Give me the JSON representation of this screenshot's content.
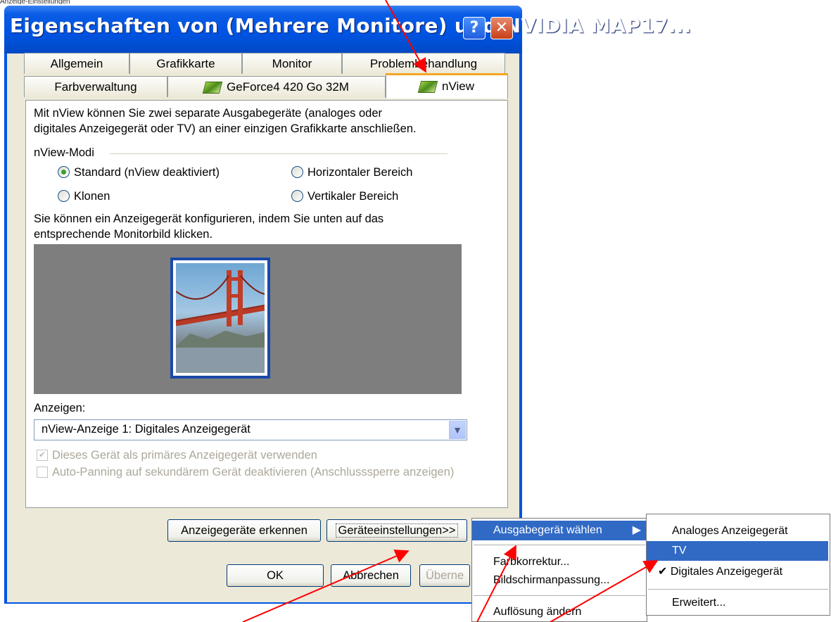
{
  "background": {
    "top_text": "Anzeige-Einstellungen"
  },
  "window": {
    "title": "Eigenschaften von (Mehrere Monitore) und NVIDIA MAP17...",
    "help_glyph": "?",
    "close_glyph": "✕"
  },
  "tabs": {
    "row1": [
      "Allgemein",
      "Grafikkarte",
      "Monitor",
      "Problembehandlung"
    ],
    "row2": [
      "Farbverwaltung",
      "GeForce4 420 Go 32M",
      "nView"
    ],
    "selected": "nView"
  },
  "nview": {
    "intro_line1": "Mit nView können Sie zwei separate Ausgabegeräte (analoges oder",
    "intro_line2": "digitales Anzeigegerät oder TV) an einer einzigen Grafikkarte anschließen.",
    "group_label": "nView-Modi",
    "modes": [
      {
        "label": "Standard (nView deaktiviert)",
        "selected": true
      },
      {
        "label": "Horizontaler Bereich",
        "selected": false
      },
      {
        "label": "Klonen",
        "selected": false
      },
      {
        "label": "Vertikaler Bereich",
        "selected": false
      }
    ],
    "config_line1": "Sie können ein Anzeigegerät konfigurieren, indem Sie unten auf das",
    "config_line2": "entsprechende Monitorbild klicken.",
    "display_label": "Anzeigen:",
    "display_value": "nView-Anzeige 1: Digitales Anzeigegerät",
    "check_primary": "Dieses Gerät als primäres Anzeigegerät verwenden",
    "check_panning": "Auto-Panning auf sekundärem Gerät deaktivieren (Anschlusssperre anzeigen)",
    "btn_detect": "Anzeigegeräte erkennen",
    "btn_device_settings": "Geräteeinstellungen>>"
  },
  "footer": {
    "ok": "OK",
    "cancel": "Abbrechen",
    "apply": "Überne"
  },
  "menu1": {
    "items": [
      "Ausgabegerät wählen",
      "Farbkorrektur...",
      "Bildschirmanpassung...",
      "Auflösung ändern"
    ],
    "highlighted": "Ausgabegerät wählen"
  },
  "menu2": {
    "items": [
      "Analoges Anzeigegerät",
      "TV",
      "Digitales Anzeigegerät",
      "Erweitert..."
    ],
    "highlighted": "TV",
    "checked": "Digitales Anzeigegerät"
  },
  "colors": {
    "title_blue": "#0054e3",
    "menu_highlight": "#316ac5",
    "arrow_red": "#ff0000",
    "tab_accent": "#f5a623"
  }
}
